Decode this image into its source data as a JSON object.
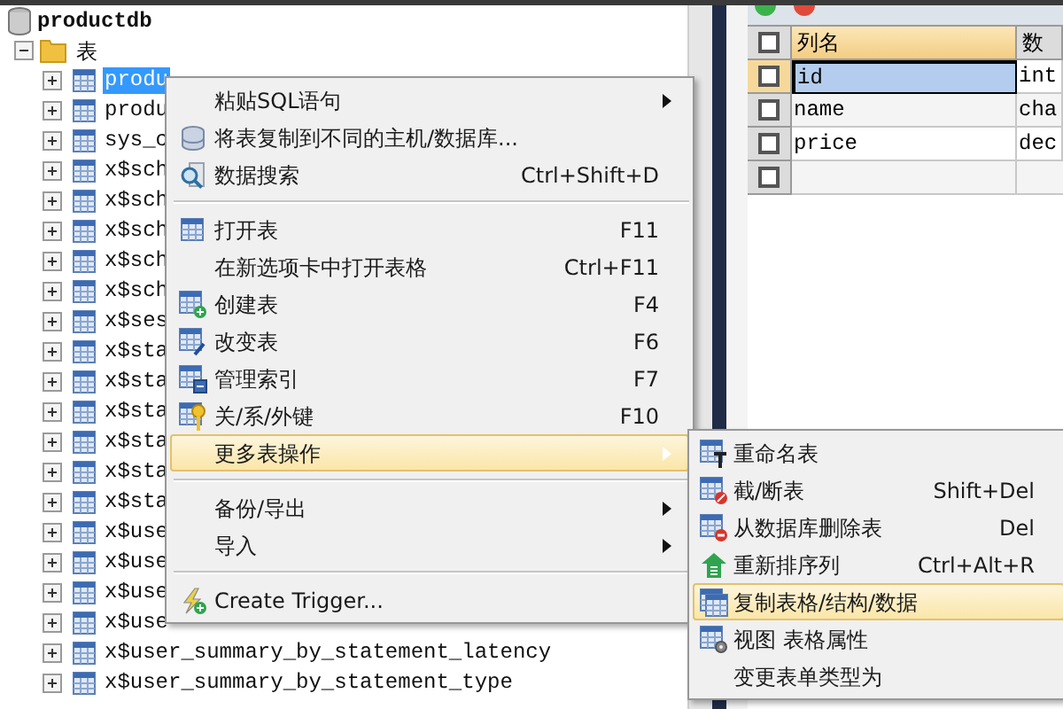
{
  "tree": {
    "label": "productdb",
    "children": [
      {
        "label": "表",
        "expanded": true,
        "children": [
          {
            "label": "produ",
            "expanded": false,
            "selected": true
          },
          {
            "label": "produ",
            "expanded": false,
            "selected": false
          },
          {
            "label": "sys_c",
            "expanded": false,
            "selected": false
          },
          {
            "label": "x$sch",
            "expanded": false,
            "selected": false
          },
          {
            "label": "x$sch",
            "expanded": false,
            "selected": false
          },
          {
            "label": "x$sch",
            "expanded": false,
            "selected": false
          },
          {
            "label": "x$sch",
            "expanded": false,
            "selected": false
          },
          {
            "label": "x$sch",
            "expanded": false,
            "selected": false
          },
          {
            "label": "x$ses",
            "expanded": false,
            "selected": false
          },
          {
            "label": "x$sta",
            "expanded": false,
            "selected": false
          },
          {
            "label": "x$sta",
            "expanded": false,
            "selected": false
          },
          {
            "label": "x$sta",
            "expanded": false,
            "selected": false
          },
          {
            "label": "x$sta",
            "expanded": false,
            "selected": false
          },
          {
            "label": "x$sta",
            "expanded": false,
            "selected": false
          },
          {
            "label": "x$sta",
            "expanded": false,
            "selected": false
          },
          {
            "label": "x$use",
            "expanded": false,
            "selected": false
          },
          {
            "label": "x$use",
            "expanded": false,
            "selected": false
          },
          {
            "label": "x$use",
            "expanded": false,
            "selected": false
          },
          {
            "label": "x$use",
            "expanded": false,
            "selected": false
          },
          {
            "label": "x$user_summary_by_statement_latency",
            "expanded": false,
            "selected": false
          },
          {
            "label": "x$user_summary_by_statement_type",
            "expanded": false,
            "selected": false
          }
        ]
      }
    ]
  },
  "grid": {
    "all_checked": false,
    "new_row_checked": false,
    "columns": [
      "列名",
      "数"
    ],
    "rows": [
      {
        "cells": [
          "id",
          "int"
        ],
        "checked": false,
        "selected": true
      },
      {
        "cells": [
          "name",
          "cha"
        ],
        "checked": false,
        "selected": false
      },
      {
        "cells": [
          "price",
          "dec"
        ],
        "checked": false,
        "selected": false
      }
    ]
  },
  "context_menu": {
    "items": [
      {
        "kind": "item",
        "label": "粘贴SQL语句",
        "submenu": true,
        "selected": false
      },
      {
        "kind": "item",
        "label": "将表复制到不同的主机/数据库...",
        "submenu": false,
        "selected": false
      },
      {
        "kind": "item",
        "label": "数据搜索",
        "shortcut": "Ctrl+Shift+D",
        "submenu": false,
        "selected": false
      },
      {
        "kind": "separator"
      },
      {
        "kind": "item",
        "label": "打开表",
        "shortcut": "F11",
        "submenu": false,
        "selected": false
      },
      {
        "kind": "item",
        "label": "在新选项卡中打开表格",
        "shortcut": "Ctrl+F11",
        "submenu": false,
        "selected": false
      },
      {
        "kind": "item",
        "label": "创建表",
        "shortcut": "F4",
        "submenu": false,
        "selected": false
      },
      {
        "kind": "item",
        "label": "改变表",
        "shortcut": "F6",
        "submenu": false,
        "selected": false
      },
      {
        "kind": "item",
        "label": "管理索引",
        "shortcut": "F7",
        "submenu": false,
        "selected": false
      },
      {
        "kind": "item",
        "label": "关/系/外键",
        "shortcut": "F10",
        "submenu": false,
        "selected": false
      },
      {
        "kind": "item",
        "label": "更多表操作",
        "submenu": true,
        "selected": true
      },
      {
        "kind": "separator"
      },
      {
        "kind": "item",
        "label": "备份/导出",
        "submenu": true,
        "selected": false
      },
      {
        "kind": "item",
        "label": "导入",
        "submenu": true,
        "selected": false
      },
      {
        "kind": "separator"
      },
      {
        "kind": "item",
        "label": "Create Trigger...",
        "submenu": false,
        "selected": false
      }
    ]
  },
  "submenu": {
    "items": [
      {
        "label": "重命名表",
        "selected": false
      },
      {
        "label": "截/断表",
        "shortcut": "Shift+Del",
        "selected": false
      },
      {
        "label": "从数据库删除表",
        "shortcut": "Del",
        "selected": false
      },
      {
        "label": "重新排序列",
        "shortcut": "Ctrl+Alt+R",
        "selected": false
      },
      {
        "label": "复制表格/结构/数据",
        "selected": true
      },
      {
        "label": "视图 表格属性",
        "selected": false
      },
      {
        "label": "变更表单类型为",
        "selected": false
      }
    ]
  }
}
